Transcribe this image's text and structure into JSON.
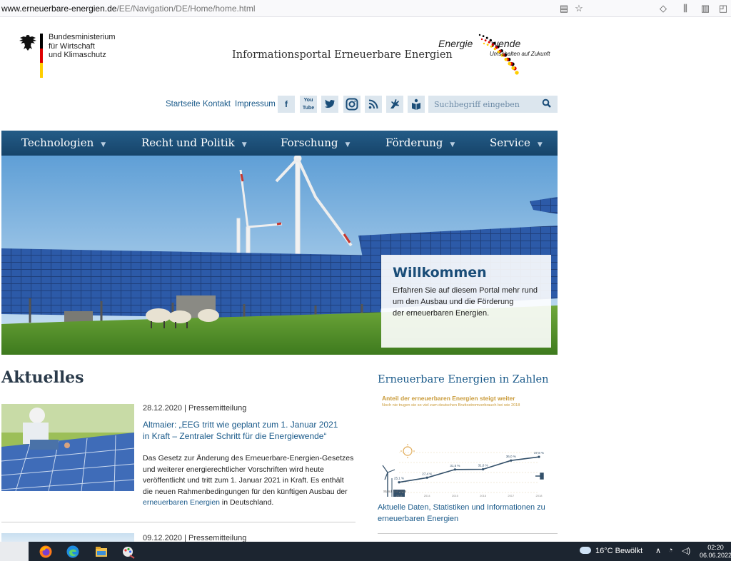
{
  "browser": {
    "url_domain": "www.erneuerbare-energien.de",
    "url_path": "/EE/Navigation/DE/Home/home.html"
  },
  "header": {
    "ministry": "Bundesministerium\nfür Wirtschaft\nund Klimaschutz",
    "portal_title": "Informationsportal Erneuerbare Energien",
    "energiewende_a": "Energie",
    "energiewende_b": "wende",
    "energiewende_tag": "Umschalten auf Zukunft"
  },
  "utility": {
    "links": [
      "Startseite",
      "Kontakt",
      "Impressum"
    ],
    "social": [
      "facebook-icon",
      "youtube-icon",
      "twitter-icon",
      "instagram-icon",
      "rss-icon",
      "sign-language-icon",
      "easy-language-icon"
    ],
    "search_placeholder": "Suchbegriff eingeben"
  },
  "nav": {
    "items": [
      "Technologien",
      "Recht und Politik",
      "Forschung",
      "Förderung",
      "Service"
    ],
    "caret": "▼"
  },
  "hero": {
    "welcome_title": "Willkommen",
    "welcome_text": "Erfahren Sie auf diesem Portal mehr rund\num den Ausbau und die Förderung\nder erneuerbaren Energien."
  },
  "news": {
    "section_title": "Aktuelles",
    "items": [
      {
        "meta": "28.12.2020 | Pressemitteilung",
        "headline": "Altmaier: „EEG tritt wie geplant zum 1. Januar 2021\nin Kraft – Zentraler Schritt für die Energiewende“",
        "text": "Das Gesetz zur Änderung des Erneuerbare-Energien-Gesetzes\nund weiterer energierechtlicher Vorschriften wird heute\nveröffentlicht und tritt zum 1. Januar 2021 in Kraft. Es enthält\ndie neuen Rahmenbedingungen für den künftigen Ausbau der",
        "link_text": "erneuerbaren Energien",
        "text_end": " in Deutschland."
      },
      {
        "meta": "09.12.2020 | Pressemitteilung"
      }
    ]
  },
  "zahlen": {
    "title": "Erneuerbare Energien in Zahlen",
    "chart_title": "Anteil der erneuerbaren Energien steigt weiter",
    "chart_subtitle": "Noch nie trugen sie so viel zum deutschen Bruttostromverbrauch bei wie 2018",
    "chart_footnote": "Stand: Juli 2019",
    "link": "Aktuelle Daten, Statistiken und Informationen zu\nerneuerbaren Energien"
  },
  "chart_data": {
    "type": "line",
    "title": "Anteil der erneuerbaren Energien steigt weiter",
    "subtitle": "Noch nie trugen sie so viel zum deutschen Bruttostromverbrauch bei wie 2018",
    "x": [
      "2013",
      "2014",
      "2015",
      "2016",
      "2017",
      "2018"
    ],
    "series": [
      {
        "values": [
          25.1,
          27.4,
          31.5,
          31.6,
          36.0,
          37.8
        ]
      }
    ],
    "data_labels": [
      "25,1 %",
      "27,4 %",
      "31,5 %",
      "31,6 %",
      "36,0 %",
      "37,8 %"
    ],
    "ylim": [
      20,
      40
    ]
  },
  "taskbar": {
    "weather": "16°C  Bewölkt",
    "time": "02:20",
    "date": "06.06.2022"
  },
  "colors": {
    "nav": "#1f5580",
    "link": "#1a5a8a",
    "accent_gold": "#c99a38",
    "flag_black": "#000000",
    "flag_red": "#dd0000",
    "flag_gold": "#ffce00"
  }
}
